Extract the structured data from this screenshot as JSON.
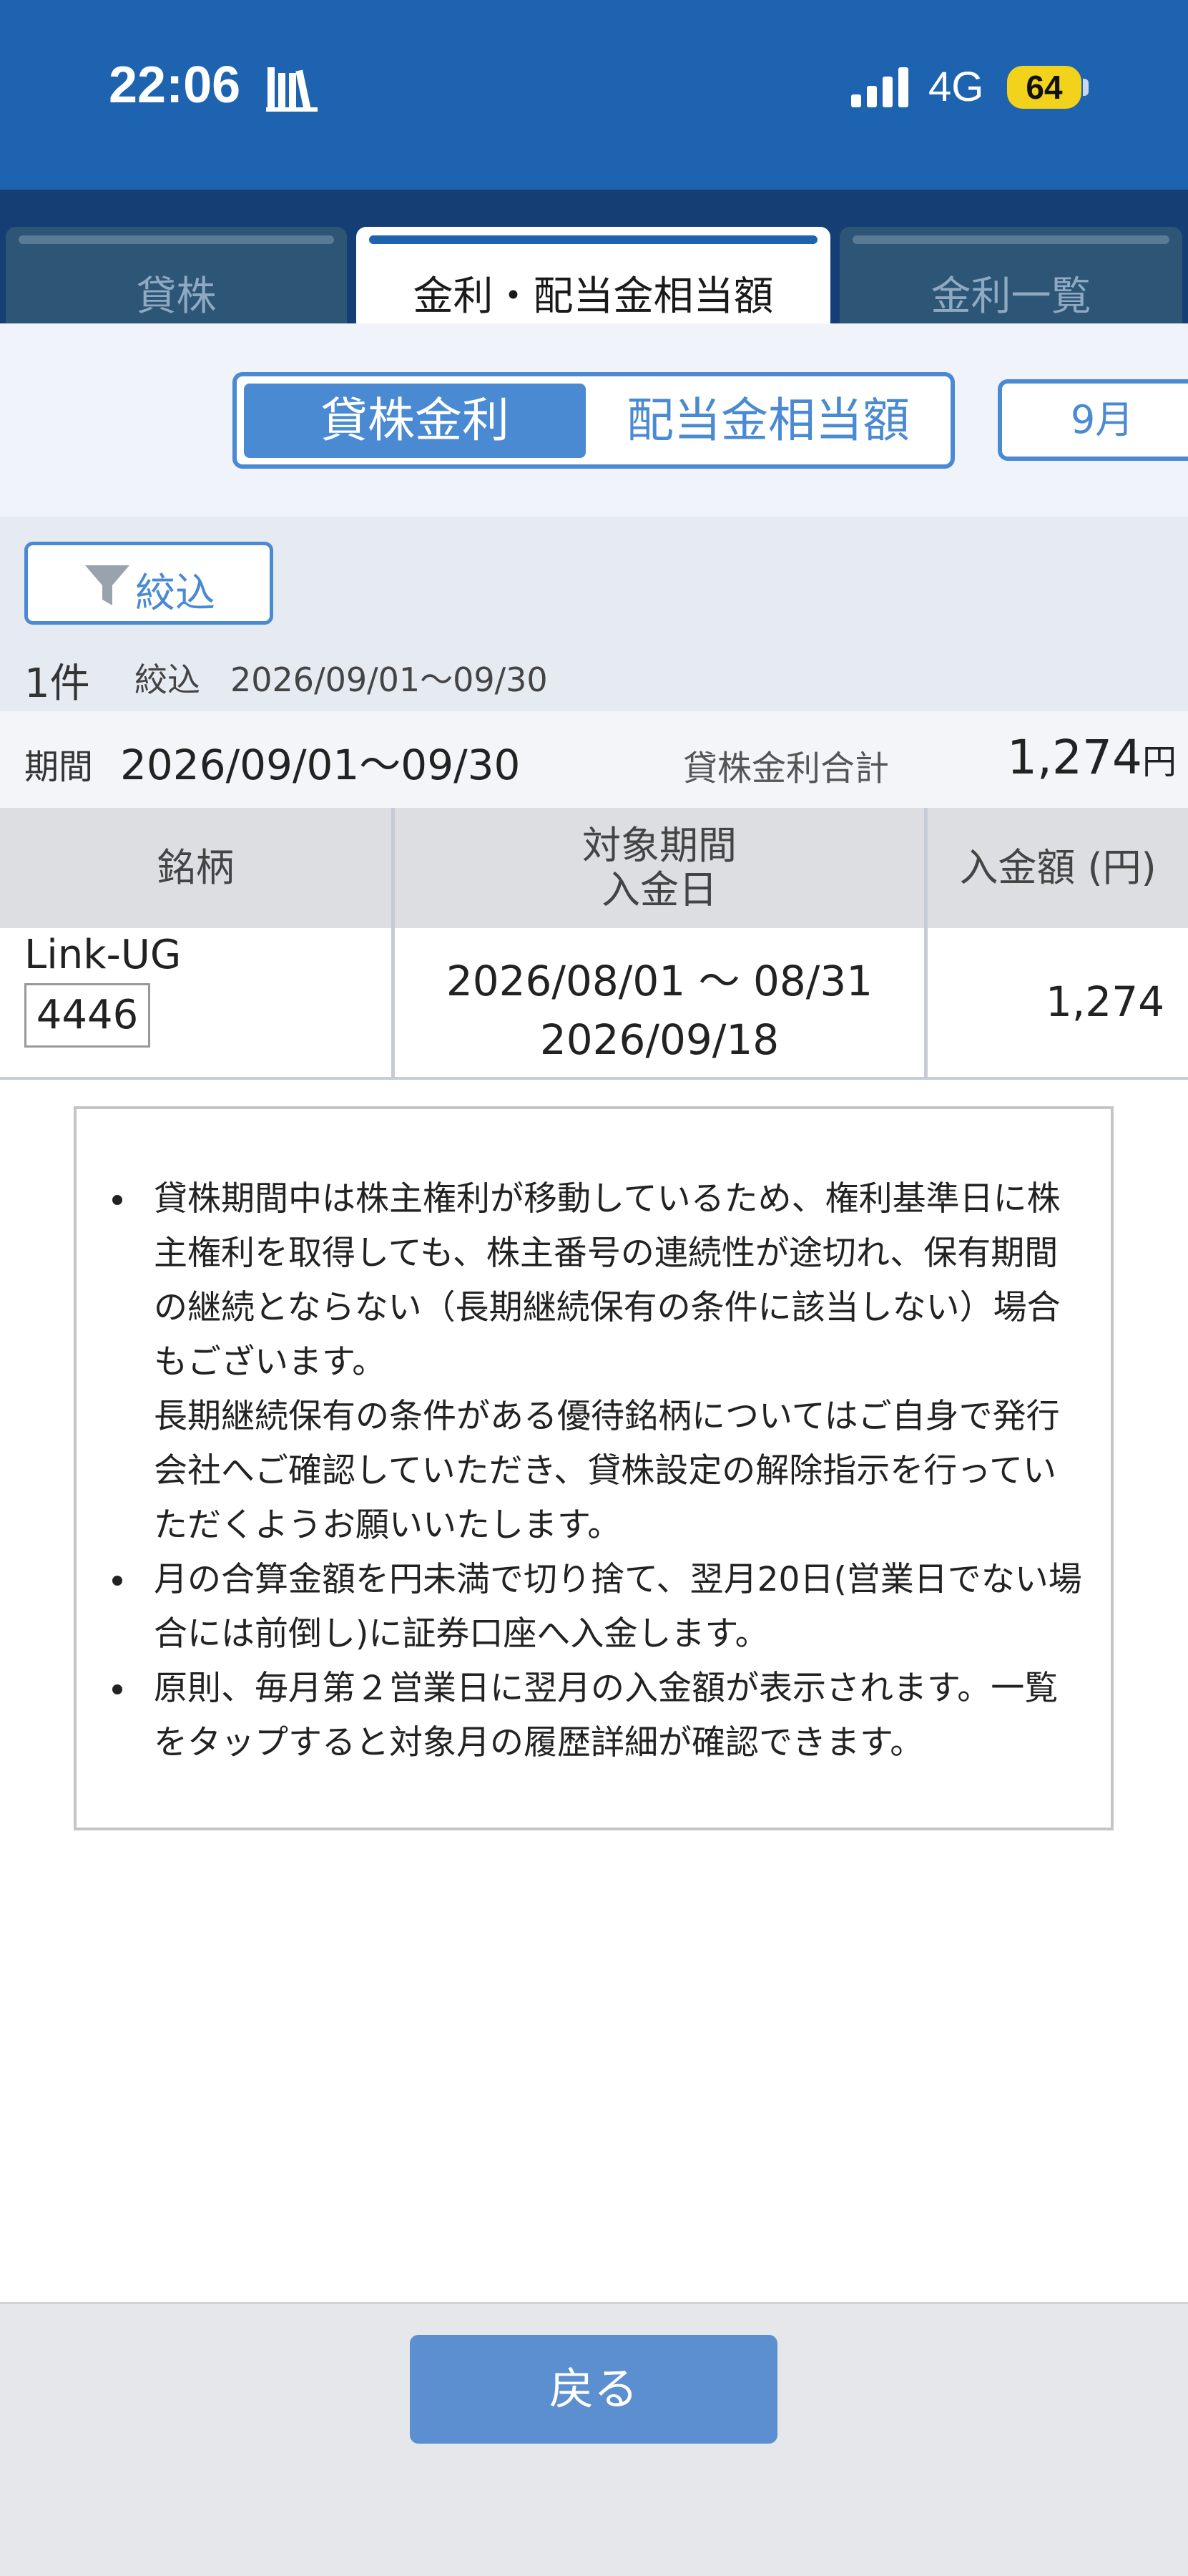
{
  "status_bar": {
    "time": "22:06",
    "network": "4G",
    "battery": "64"
  },
  "tabs": [
    {
      "label": "貸株",
      "active": false
    },
    {
      "label": "金利・配当金相当額",
      "active": true
    },
    {
      "label": "金利一覧",
      "active": false
    }
  ],
  "segment": {
    "selected": "貸株金利",
    "other": "配当金相当額",
    "month": "9月"
  },
  "filter": {
    "button_label": "絞込",
    "count": "1件",
    "summary_label": "絞込",
    "summary_range": "2026/09/01〜09/30"
  },
  "period_summary": {
    "label": "期間",
    "value": "2026/09/01〜09/30",
    "total_label": "貸株金利合計",
    "total_value": "1,274",
    "total_unit": "円"
  },
  "table": {
    "headers": {
      "stock": "銘柄",
      "period_line1": "対象期間",
      "period_line2": "入金日",
      "amount": "入金額 (円)"
    },
    "rows": [
      {
        "name": "Link-UG",
        "code": "4446",
        "period": "2026/08/01 〜 08/31",
        "payment_date": "2026/09/18",
        "amount": "1,274"
      }
    ]
  },
  "notice": {
    "items": [
      {
        "text": "貸株期間中は株主権利が移動しているため、権利基準日に株主権利を取得しても、株主番号の連続性が途切れ、保有期間の継続とならない（長期継続保有の条件に該当しない）場合もございます。",
        "sub": "長期継続保有の条件がある優待銘柄についてはご自身で発行会社へご確認していただき、貸株設定の解除指示を行っていただくようお願いいたします。"
      },
      {
        "text": "月の合算金額を円未満で切り捨て、翌月20日(営業日でない場合には前倒し)に証券口座へ入金します。"
      },
      {
        "text": "原則、毎月第２営業日に翌月の入金額が表示されます。一覧をタップすると対象月の履歴詳細が確認できます。"
      }
    ]
  },
  "footer": {
    "back_label": "戻る"
  },
  "colors": {
    "status_bar": "#1e63b0",
    "tab_bar": "#153f74",
    "accent": "#4a8ad2",
    "battery": "#f2d21b",
    "back_button": "#5b8fd0"
  }
}
